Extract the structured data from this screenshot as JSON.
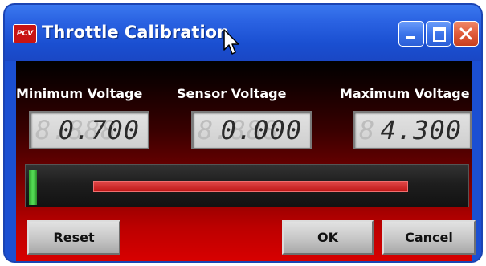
{
  "window": {
    "title": "Throttle Calibration",
    "app_icon_text": "PCV",
    "app_icon_color": "#c81414",
    "controls": [
      "minimize-icon",
      "maximize-icon",
      "close-icon"
    ]
  },
  "readouts": {
    "minimum": {
      "label": "Minimum Voltage",
      "ghost": "8.888",
      "value": "0.700"
    },
    "sensor": {
      "label": "Sensor Voltage",
      "ghost": "8.888",
      "value": "0.000"
    },
    "maximum": {
      "label": "Maximum Voltage",
      "ghost": "8",
      "value": "4.300"
    }
  },
  "gauge": {
    "sensor_voltage": 0.0,
    "range_min_voltage": 0.7,
    "range_max_voltage": 4.3,
    "indicator_color": "#44cc44",
    "range_color": "#d42020"
  },
  "buttons": {
    "reset": "Reset",
    "ok": "OK",
    "cancel": "Cancel"
  },
  "colors": {
    "titlebar": "#2a62e2",
    "background_bottom": "#d90000",
    "close_button": "#e05a3a"
  }
}
